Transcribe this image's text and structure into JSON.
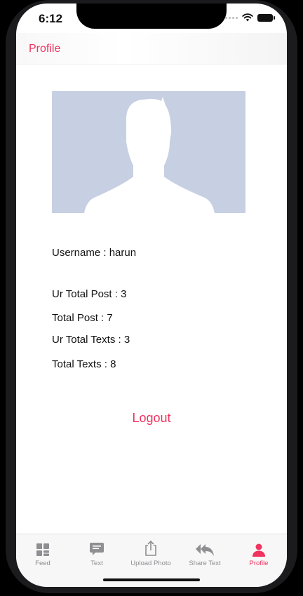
{
  "status_bar": {
    "time": "6:12"
  },
  "nav": {
    "title": "Profile"
  },
  "profile": {
    "username_line": "Username : harun",
    "ur_total_post_line": "Ur Total Post : 3",
    "total_post_line": "Total Post : 7",
    "ur_total_texts_line": "Ur Total Texts : 3",
    "total_texts_line": "Total Texts : 8"
  },
  "actions": {
    "logout_label": "Logout"
  },
  "tabbar": {
    "active_tab": "Profile",
    "items": [
      {
        "label": "Feed",
        "icon": "grid-icon"
      },
      {
        "label": "Text",
        "icon": "speech-bubble-icon"
      },
      {
        "label": "Upload Photo",
        "icon": "share-upload-icon"
      },
      {
        "label": "Share Text",
        "icon": "reply-all-icon"
      },
      {
        "label": "Profile",
        "icon": "person-icon"
      }
    ]
  },
  "colors": {
    "accent": "#f0335f",
    "avatar_bg": "#c6d0e2",
    "inactive_tab": "#8e8e93"
  }
}
